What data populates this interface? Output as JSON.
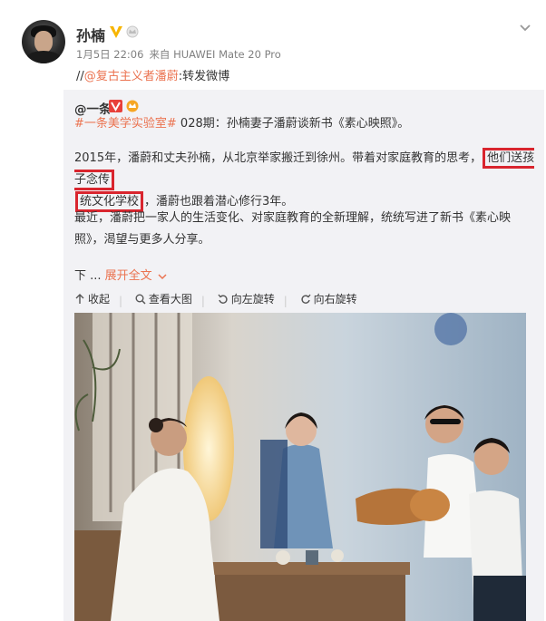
{
  "post": {
    "author": "孙楠",
    "date": "1月5日 22:06",
    "source": "来自 HUAWEI Mate 20 Pro",
    "repost_prefix": "//",
    "repost_mention": "@复古主义者潘蔚",
    "repost_suffix": ":转发微博"
  },
  "original": {
    "author": "@一条",
    "topic": "#一条美学实验室#",
    "line1_rest": " 028期：孙楠妻子潘蔚谈新书《素心映照》。",
    "p1_part1": "2015年，潘蔚和丈夫孙楠，从北京举家搬迁到徐州。带着对家庭教育的思考，",
    "p1_highlight1": "他们送孩子念传",
    "p1_highlight2": "统文化学校",
    "p1_part2": "，潘蔚也跟着潜心修行3年。",
    "p2": "最近，潘蔚把一家人的生活变化、对家庭教育的全新理解，统统写进了新书《素心映照》，渴望与更多人分享。",
    "more_prefix": "下 ...",
    "expand_label": "展开全文",
    "actions": {
      "collapse": "收起",
      "view_large": "查看大图",
      "rotate_left": "向左旋转",
      "rotate_right": "向右旋转"
    }
  },
  "colors": {
    "accent": "#eb7350",
    "highlight": "#d9252e",
    "meta": "#808080",
    "repost_bg": "#f2f2f5"
  }
}
